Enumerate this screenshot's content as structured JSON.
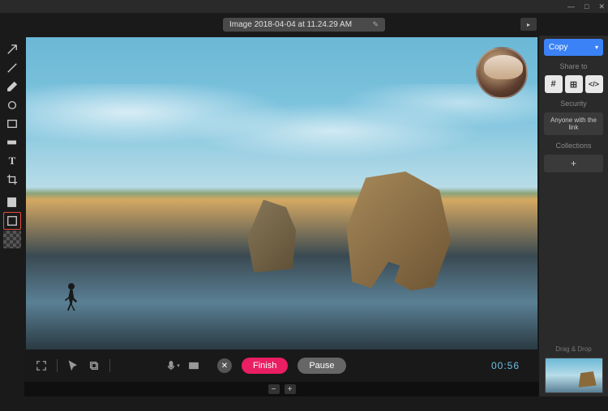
{
  "window": {
    "min": "—",
    "max": "□",
    "close": "✕"
  },
  "title": {
    "filename": "Image 2018-04-04 at 11.24.29 AM"
  },
  "expand": "▸",
  "tools": {
    "arrow": "arrow",
    "line": "line",
    "pen": "pen",
    "ellipse": "ellipse",
    "rect": "rect",
    "blur": "blur",
    "text": "T",
    "crop": "crop",
    "resize": "resize",
    "border": "border"
  },
  "recording": {
    "finish": "Finish",
    "pause": "Pause",
    "timer": "00:56",
    "close": "✕"
  },
  "zoom": {
    "minus": "−",
    "plus": "+"
  },
  "sidebar": {
    "copy": "Copy",
    "shareto": "Share to",
    "share": {
      "slack": "#",
      "trello": "⊞",
      "embed": "</>"
    },
    "security_label": "Security",
    "security_btn": "Anyone with the link",
    "collections": "Collections",
    "add": "+",
    "dragdrop": "Drag & Drop"
  }
}
